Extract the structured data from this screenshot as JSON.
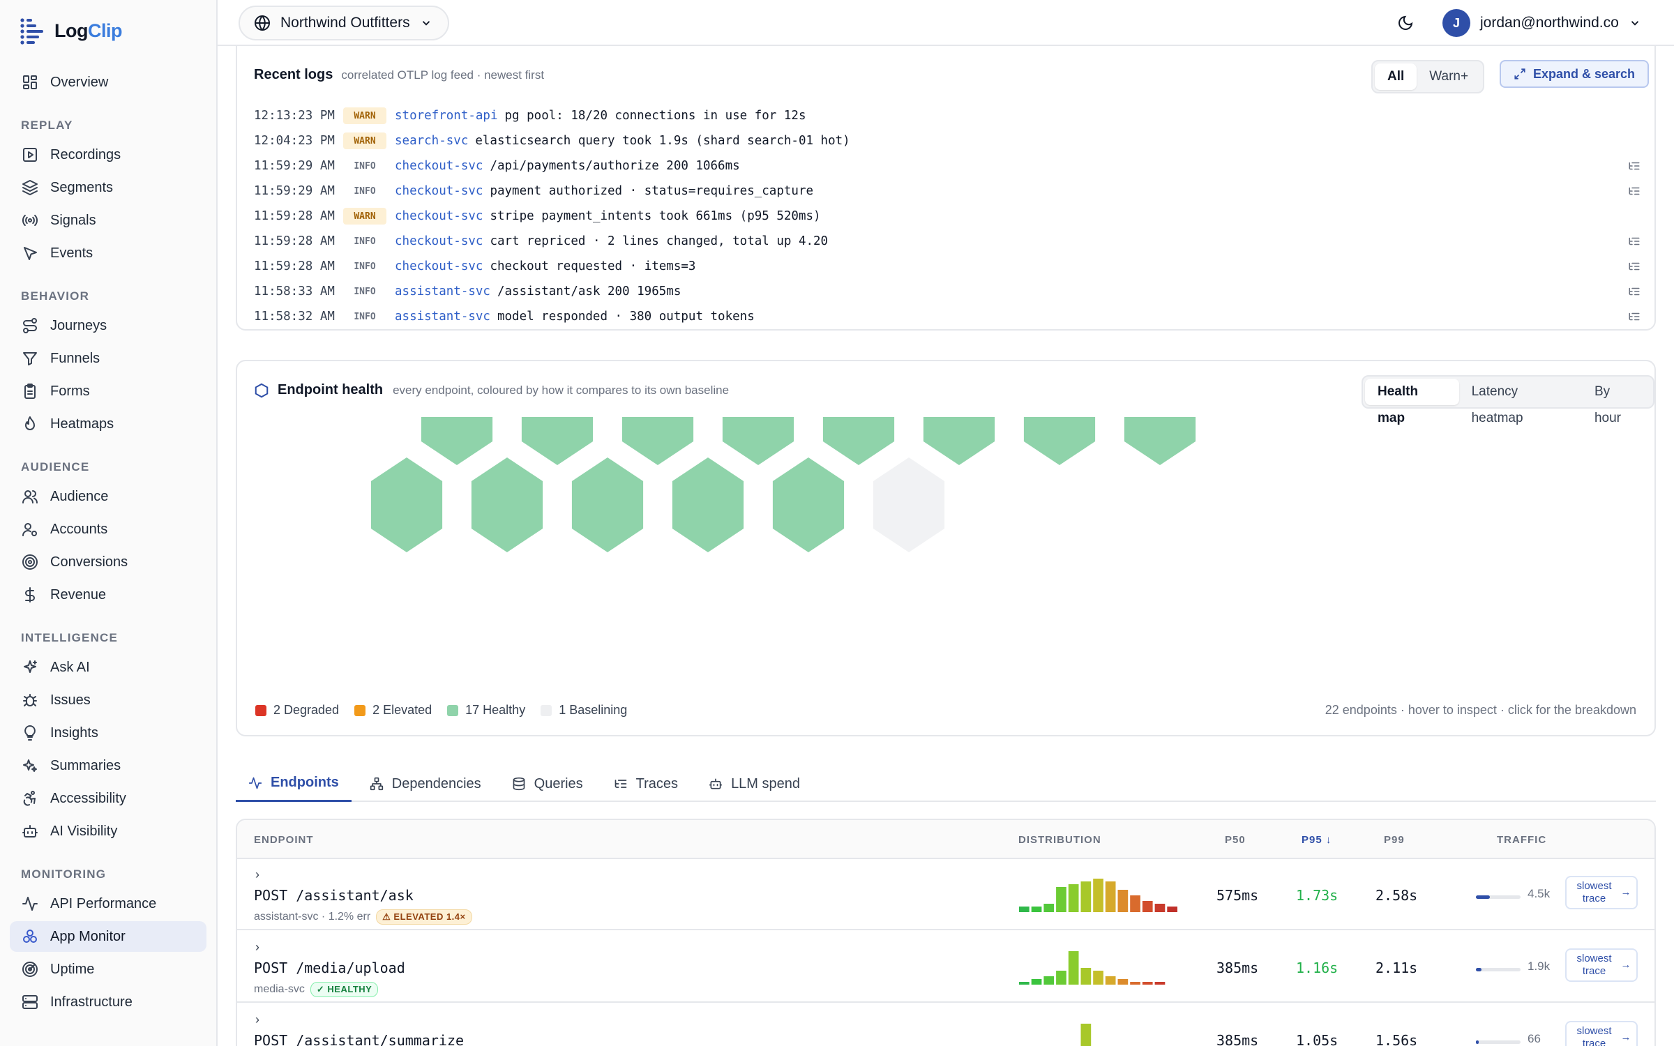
{
  "app": {
    "name_part1": "Log",
    "name_part2": "Clip"
  },
  "topbar": {
    "org": "Northwind Outfitters",
    "user_initial": "J",
    "user_email": "jordan@northwind.co"
  },
  "sidebar": {
    "overview": "Overview",
    "sections": [
      {
        "title": "REPLAY",
        "items": [
          {
            "label": "Recordings",
            "icon": "play-square-icon"
          },
          {
            "label": "Segments",
            "icon": "layers-icon"
          },
          {
            "label": "Signals",
            "icon": "radio-icon"
          },
          {
            "label": "Events",
            "icon": "cursor-icon"
          }
        ]
      },
      {
        "title": "BEHAVIOR",
        "items": [
          {
            "label": "Journeys",
            "icon": "route-icon"
          },
          {
            "label": "Funnels",
            "icon": "funnel-icon"
          },
          {
            "label": "Forms",
            "icon": "clipboard-icon"
          },
          {
            "label": "Heatmaps",
            "icon": "flame-icon"
          }
        ]
      },
      {
        "title": "AUDIENCE",
        "items": [
          {
            "label": "Audience",
            "icon": "users-icon"
          },
          {
            "label": "Accounts",
            "icon": "user-cog-icon"
          },
          {
            "label": "Conversions",
            "icon": "target-icon"
          },
          {
            "label": "Revenue",
            "icon": "dollar-icon"
          }
        ]
      },
      {
        "title": "INTELLIGENCE",
        "items": [
          {
            "label": "Ask AI",
            "icon": "sparkles-icon"
          },
          {
            "label": "Issues",
            "icon": "bug-icon"
          },
          {
            "label": "Insights",
            "icon": "lightbulb-icon"
          },
          {
            "label": "Summaries",
            "icon": "sparkle-icon"
          },
          {
            "label": "Accessibility",
            "icon": "accessibility-icon"
          },
          {
            "label": "AI Visibility",
            "icon": "bot-icon"
          }
        ]
      },
      {
        "title": "MONITORING",
        "items": [
          {
            "label": "API Performance",
            "icon": "activity-icon"
          },
          {
            "label": "App Monitor",
            "icon": "boxes-icon",
            "active": true
          },
          {
            "label": "Uptime",
            "icon": "radar-icon"
          },
          {
            "label": "Infrastructure",
            "icon": "server-icon"
          }
        ]
      }
    ]
  },
  "logs": {
    "title": "Recent logs",
    "subtitle": "correlated OTLP log feed · newest first",
    "filters": [
      "All",
      "Warn+"
    ],
    "expand_label": "Expand & search",
    "rows": [
      {
        "time": "12:13:23 PM",
        "level": "WARN",
        "svc": "storefront-api",
        "msg": "pg pool: 18/20 connections in use for 12s"
      },
      {
        "time": "12:04:23 PM",
        "level": "WARN",
        "svc": "search-svc",
        "msg": "elasticsearch query took 1.9s (shard search-01 hot)"
      },
      {
        "time": "11:59:29 AM",
        "level": "INFO",
        "svc": "checkout-svc",
        "msg": "/api/payments/authorize 200 1066ms"
      },
      {
        "time": "11:59:29 AM",
        "level": "INFO",
        "svc": "checkout-svc",
        "msg": "payment authorized · status=requires_capture"
      },
      {
        "time": "11:59:28 AM",
        "level": "WARN",
        "svc": "checkout-svc",
        "msg": "stripe payment_intents took 661ms (p95 520ms)"
      },
      {
        "time": "11:59:28 AM",
        "level": "INFO",
        "svc": "checkout-svc",
        "msg": "cart repriced · 2 lines changed, total up 4.20"
      },
      {
        "time": "11:59:28 AM",
        "level": "INFO",
        "svc": "checkout-svc",
        "msg": "checkout requested · items=3"
      },
      {
        "time": "11:58:33 AM",
        "level": "INFO",
        "svc": "assistant-svc",
        "msg": "/assistant/ask 200 1965ms"
      },
      {
        "time": "11:58:32 AM",
        "level": "INFO",
        "svc": "assistant-svc",
        "msg": "model responded · 380 output tokens"
      }
    ]
  },
  "health": {
    "title": "Endpoint health",
    "subtitle": "every endpoint, coloured by how it compares to its own baseline",
    "views": [
      "Health map",
      "Latency heatmap",
      "By hour"
    ],
    "colors": {
      "degraded": "#dc3526",
      "elevated": "#f29a1a",
      "healthy": "#8fd3aa",
      "baselining": "#f1f2f4"
    },
    "hex_rows": [
      [
        "degraded",
        "degraded",
        "elevated",
        "elevated",
        "healthy",
        "healthy",
        "healthy",
        "healthy"
      ],
      [
        "healthy",
        "healthy",
        "healthy",
        "healthy",
        "healthy",
        "healthy",
        "healthy",
        "healthy"
      ],
      [
        "healthy",
        "healthy",
        "healthy",
        "healthy",
        "healthy",
        "baselining"
      ]
    ],
    "legend": [
      {
        "label": "2 Degraded",
        "color": "#dc3526"
      },
      {
        "label": "2 Elevated",
        "color": "#f29a1a"
      },
      {
        "label": "17 Healthy",
        "color": "#8fd3aa"
      },
      {
        "label": "1 Baselining",
        "color": "#eeeff1"
      }
    ],
    "footer": "22 endpoints · hover to inspect · click for the breakdown"
  },
  "tabs": [
    {
      "label": "Endpoints",
      "icon": "activity-icon",
      "active": true
    },
    {
      "label": "Dependencies",
      "icon": "network-icon"
    },
    {
      "label": "Queries",
      "icon": "database-icon"
    },
    {
      "label": "Traces",
      "icon": "list-tree-icon"
    },
    {
      "label": "LLM spend",
      "icon": "bot-icon"
    }
  ],
  "endpoints": {
    "headers": {
      "endpoint": "ENDPOINT",
      "distribution": "DISTRIBUTION",
      "p50": "P50",
      "p95": "P95 ↓",
      "p99": "P99",
      "traffic": "TRAFFIC"
    },
    "rows": [
      {
        "name": "POST /assistant/ask",
        "svc": "assistant-svc · 1.2% err",
        "badge": "ELEVATED 1.4×",
        "badge_type": "elev",
        "p50": "575ms",
        "p95": "1.73s",
        "p99": "2.58s",
        "traffic": "4.5k",
        "traffic_frac": 0.05,
        "dist": [
          2,
          2,
          3,
          9,
          10,
          11,
          12,
          11,
          8,
          6,
          4,
          3,
          2
        ],
        "slow_label": "slowest trace"
      },
      {
        "name": "POST /media/upload",
        "svc": "media-svc",
        "badge": "HEALTHY",
        "badge_type": "ok",
        "p50": "385ms",
        "p95": "1.16s",
        "p99": "2.11s",
        "traffic": "1.9k",
        "traffic_frac": 0.02,
        "dist": [
          1,
          2,
          3,
          5,
          12,
          6,
          5,
          3,
          2,
          1,
          1,
          1
        ],
        "slow_label": "slowest trace"
      },
      {
        "name": "POST /assistant/summarize",
        "svc": "",
        "badge": "",
        "badge_type": "",
        "p50": "385ms",
        "p95": "1.05s",
        "p99": "1.56s",
        "traffic": "66",
        "traffic_frac": 0.01,
        "dist": [
          0,
          0,
          0,
          0,
          0,
          12,
          0,
          0,
          0,
          0,
          0,
          0
        ],
        "slow_label": "slowest trace"
      }
    ]
  }
}
